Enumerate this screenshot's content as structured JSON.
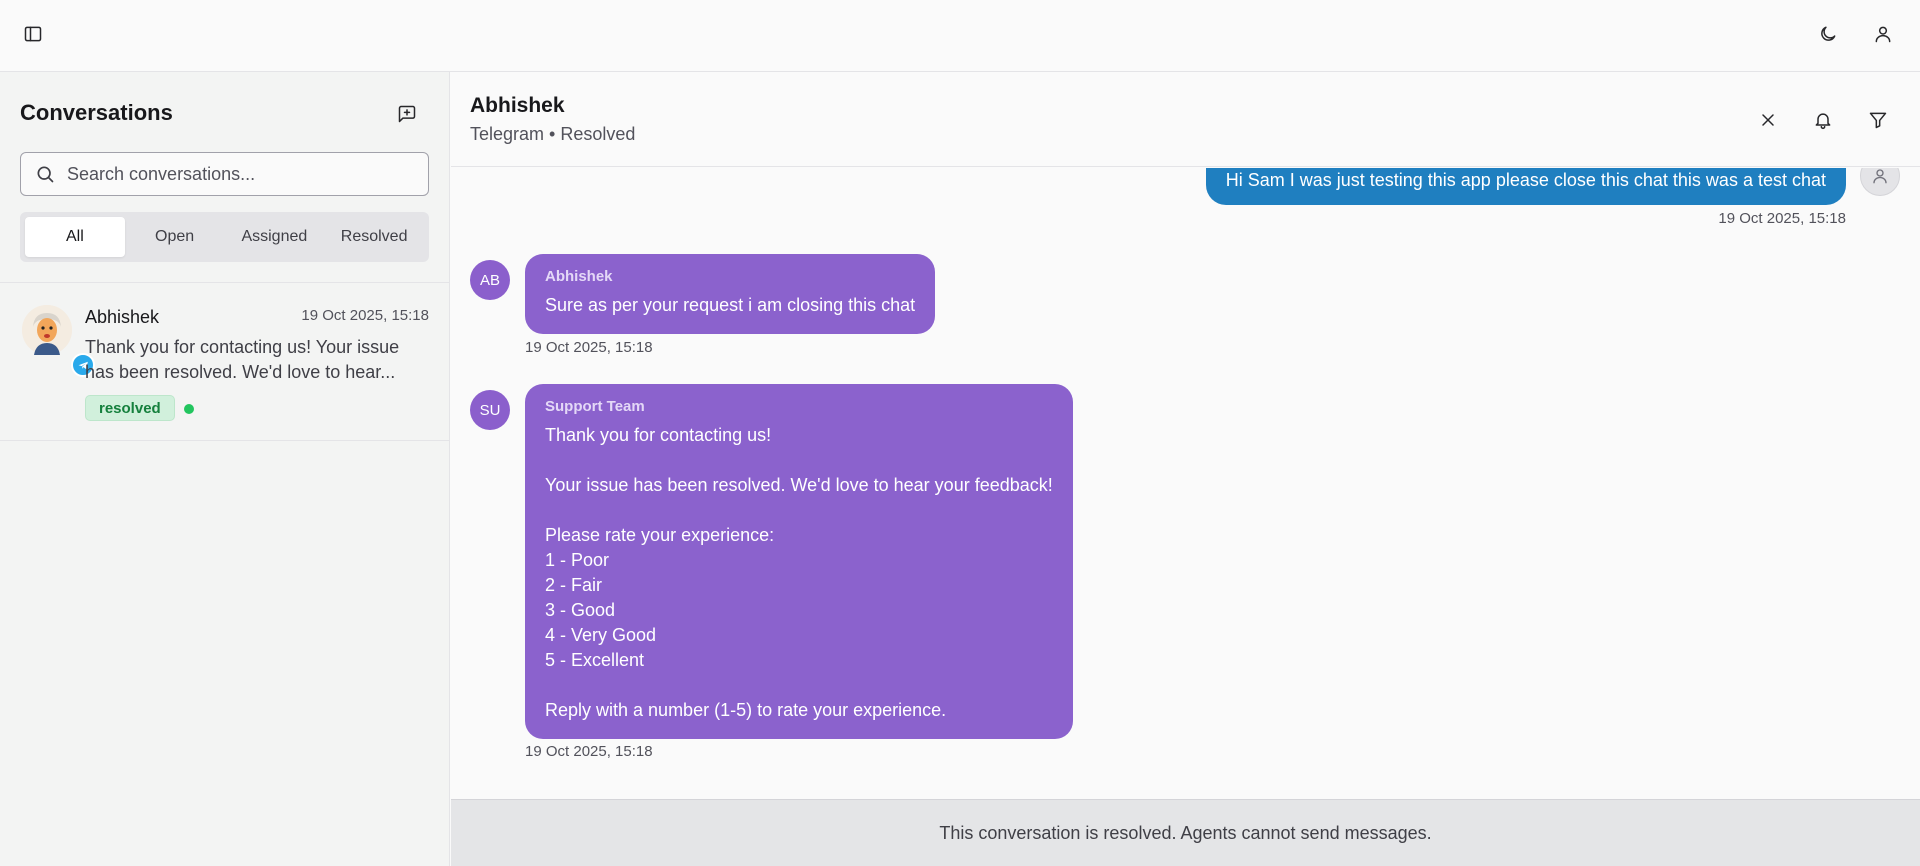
{
  "topbar": {
    "sidebar_toggle_icon": "panel-left-icon",
    "theme_icon": "moon-icon",
    "user_icon": "user-icon"
  },
  "sidebar": {
    "title": "Conversations",
    "new_chat_icon": "message-plus-icon",
    "search": {
      "placeholder": "Search conversations...",
      "value": ""
    },
    "tabs": [
      {
        "label": "All",
        "active": true
      },
      {
        "label": "Open",
        "active": false
      },
      {
        "label": "Assigned",
        "active": false
      },
      {
        "label": "Resolved",
        "active": false
      }
    ],
    "conversations": [
      {
        "name": "Abhishek",
        "time": "19 Oct 2025, 15:18",
        "preview": "Thank you for contacting us! Your issue has been resolved. We'd love to hear...",
        "status": "resolved",
        "channel": "telegram",
        "online": true
      }
    ]
  },
  "chat": {
    "title": "Abhishek",
    "subtitle": "Telegram • Resolved",
    "actions": [
      "close-icon",
      "bell-icon",
      "filter-icon"
    ],
    "messages": [
      {
        "direction": "outgoing",
        "text": "Hi Sam I was just testing this app please close this chat this was a test chat",
        "time": "19 Oct 2025, 15:18"
      },
      {
        "direction": "incoming",
        "avatar": "AB",
        "sender": "Abhishek",
        "text": "Sure as per your request i am closing this chat",
        "time": "19 Oct 2025, 15:18"
      },
      {
        "direction": "incoming",
        "avatar": "SU",
        "sender": "Support Team",
        "text": "Thank you for contacting us!\n\nYour issue has been resolved. We'd love to hear your feedback!\n\nPlease rate your experience:\n1 - Poor\n2 - Fair\n3 - Good\n4 - Very Good\n5 - Excellent\n\nReply with a number (1-5) to rate your experience.",
        "time": "19 Oct 2025, 15:18"
      }
    ],
    "resolved_notice": "This conversation is resolved. Agents cannot send messages."
  },
  "colors": {
    "outgoing_bubble": "#1f7fc0",
    "incoming_bubble": "#8b62cd",
    "resolved_badge_text": "#15803d",
    "online_dot": "#22c55e"
  }
}
